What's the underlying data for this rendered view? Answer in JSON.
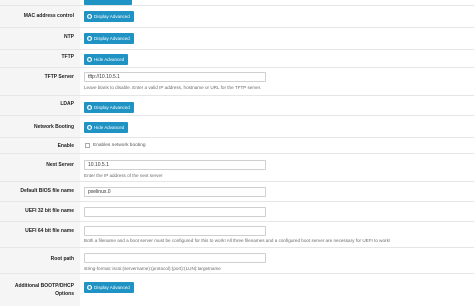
{
  "rows": {
    "mac": {
      "label": "MAC address control",
      "button": "Display Advanced"
    },
    "ntp": {
      "label": "NTP",
      "button": "Display Advanced"
    },
    "tftp": {
      "label": "TFTP",
      "button": "Hide Advanced"
    },
    "tftp_server": {
      "label": "TFTP Server",
      "value": "tftp://10.10.5.1",
      "help": "Leave blank to disable. Enter a valid IP address, hostname or URL for the TFTP server."
    },
    "ldap": {
      "label": "LDAP",
      "button": "Display Advanced"
    },
    "netboot": {
      "label": "Network Booting",
      "button": "Hide Advanced"
    },
    "enable": {
      "label": "Enable",
      "checkbox_label": "Enables network booting"
    },
    "next_server": {
      "label": "Next Server",
      "value": "10.10.5.1",
      "help": "Enter the IP address of the next server"
    },
    "default_bios": {
      "label": "Default BIOS file name",
      "value": "pxelinux.0"
    },
    "uefi32": {
      "label": "UEFI 32 bit file name",
      "value": ""
    },
    "uefi64": {
      "label": "UEFI 64 bit file name",
      "value": "",
      "help": "Both a filename and a boot server must be configured for this to work! All three filenames and a configured boot server are necessary for UEFI to work!"
    },
    "root_path": {
      "label": "Root path",
      "value": "",
      "help": "string-format: iscsi:(servername):(protocol):(port):(LUN):targetname"
    },
    "bootp": {
      "label_1": "Additional BOOTP/DHCP",
      "label_2": "Options",
      "button": "Display Advanced"
    }
  },
  "icons": {
    "button_icon": "gear-icon"
  }
}
